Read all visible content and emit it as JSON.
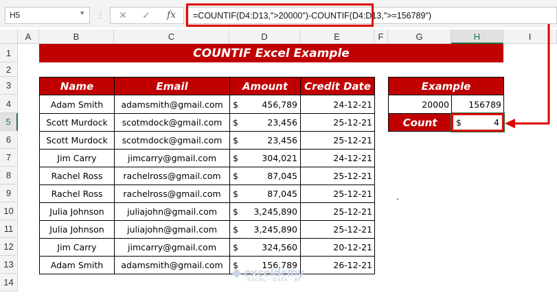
{
  "namebox": "H5",
  "formula": "=COUNTIF(D4:D13,\">20000\")-COUNTIF(D4:D13,\">=156789\")",
  "icons": {
    "cancel": "✕",
    "enter": "✓",
    "fx": "fx"
  },
  "columns": [
    "A",
    "B",
    "C",
    "D",
    "E",
    "F",
    "G",
    "H",
    "I"
  ],
  "rows": [
    "1",
    "2",
    "3",
    "4",
    "5",
    "6",
    "7",
    "8",
    "9",
    "10",
    "11",
    "12",
    "13",
    "14"
  ],
  "title": "COUNTIF Excel Example",
  "table": {
    "headers": [
      "Name",
      "Email",
      "Amount",
      "Credit Date"
    ],
    "currency": "$",
    "rows": [
      [
        "Adam Smith",
        "adamsmith@gmail.com",
        "456,789",
        "24-12-21"
      ],
      [
        "Scott Murdock",
        "scotmdock@gmail.com",
        "23,456",
        "25-12-21"
      ],
      [
        "Scott Murdock",
        "scotmdock@gmail.com",
        "23,456",
        "25-12-21"
      ],
      [
        "Jim Carry",
        "jimcarry@gmail.com",
        "304,021",
        "24-12-21"
      ],
      [
        "Rachel Ross",
        "rachelross@gmail.com",
        "87,045",
        "25-12-21"
      ],
      [
        "Rachel Ross",
        "rachelross@gmail.com",
        "87,045",
        "25-12-21"
      ],
      [
        "Julia Johnson",
        "juliajohn@gmail.com",
        "3,245,890",
        "25-12-21"
      ],
      [
        "Julia Johnson",
        "juliajohn@gmail.com",
        "3,245,890",
        "25-12-21"
      ],
      [
        "Jim Carry",
        "jimcarry@gmail.com",
        "324,560",
        "20-12-21"
      ],
      [
        "Adam Smith",
        "adamsmith@gmail.com",
        "156,789",
        "26-12-21"
      ]
    ]
  },
  "example": {
    "header": "Example",
    "v1": "20000",
    "v2": "156789",
    "count_label": "Count",
    "currency": "$",
    "count": "4"
  },
  "stray_dot": ".",
  "watermark": "exceldemy EXCEL · DATA · BI"
}
